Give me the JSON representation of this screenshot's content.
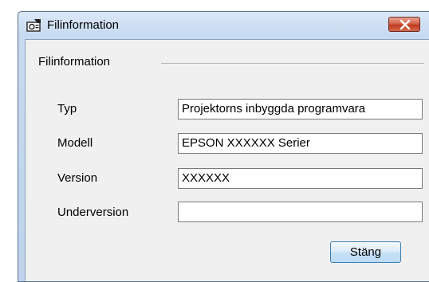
{
  "window": {
    "title": "Filinformation",
    "close_tooltip_icon": "close-x-icon"
  },
  "group": {
    "label": "Filinformation"
  },
  "fields": [
    {
      "label": "Typ",
      "value": "Projektorns inbyggda programvara"
    },
    {
      "label": "Modell",
      "value": "EPSON XXXXXX Serier"
    },
    {
      "label": "Version",
      "value": "XXXXXX"
    },
    {
      "label": "Underversion",
      "value": ""
    }
  ],
  "buttons": {
    "close_label": "Stäng"
  },
  "colors": {
    "title_close": "#c9452c",
    "button_border": "#3c7fb1"
  }
}
